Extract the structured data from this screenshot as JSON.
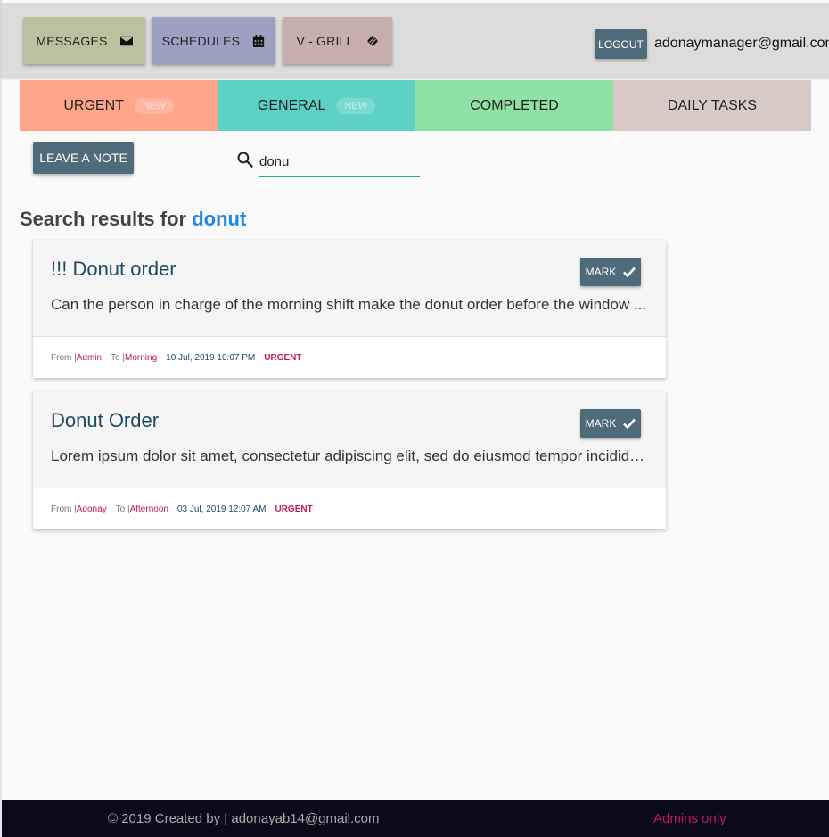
{
  "header": {
    "nav": [
      {
        "label": "MESSAGES",
        "icon": "envelope-icon"
      },
      {
        "label": "SCHEDULES",
        "icon": "calendar-icon"
      },
      {
        "label": "V - GRILL",
        "icon": "grill-icon"
      }
    ],
    "logout_label": "LOGOUT",
    "user_email": "adonaymanager@gmail.com"
  },
  "tabs": [
    {
      "label": "URGENT",
      "badge": "NEW",
      "color": "#ffa58a"
    },
    {
      "label": "GENERAL",
      "badge": "NEW",
      "color": "#5dd1c4"
    },
    {
      "label": "COMPLETED",
      "color": "#90e1a5"
    },
    {
      "label": "DAILY TASKS",
      "color": "#d8cac7"
    }
  ],
  "leave_note_label": "LEAVE A NOTE",
  "search": {
    "value": "donu"
  },
  "results": {
    "prefix": "Search results for ",
    "query": "donut"
  },
  "cards": [
    {
      "title": "!!! Donut order",
      "body": "Can the person in charge of the morning shift make the donut order before the window ...",
      "mark_label": "MARK",
      "from_label": "From | ",
      "from": "Admin",
      "to_label": "To | ",
      "to": "Morning",
      "date": "10 Jul, 2019 10:07 PM",
      "priority": "URGENT"
    },
    {
      "title": "Donut Order",
      "body": "Lorem ipsum dolor sit amet, consectetur adipiscing elit, sed do eiusmod tempor incididunt ut labore",
      "mark_label": "MARK",
      "from_label": "From | ",
      "from": "Adonay",
      "to_label": "To | ",
      "to": "Afternoon",
      "date": "03 Jul, 2019 12:07 AM",
      "priority": "URGENT"
    }
  ],
  "footer": {
    "copyright": "© 2019 Created by | adonayab14@gmail.com",
    "admins": "Admins only"
  },
  "colors": {
    "accent": "#4f6a78",
    "link": "#1e88e5",
    "highlight": "#c2185b",
    "search_underline": "#26a69a"
  }
}
